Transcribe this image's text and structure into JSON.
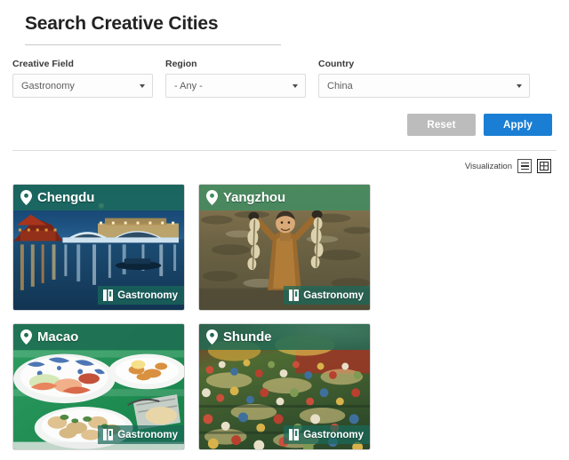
{
  "header": {
    "title": "Search Creative Cities"
  },
  "filters": {
    "fields": [
      {
        "label": "Creative Field",
        "value": "Gastronomy",
        "icon": "chevron-down-icon"
      },
      {
        "label": "Region",
        "value": "- Any -",
        "icon": "chevron-down-icon"
      },
      {
        "label": "Country",
        "value": "China",
        "icon": "chevron-down-icon"
      }
    ]
  },
  "actions": {
    "reset_label": "Reset",
    "apply_label": "Apply",
    "reset_color": "#bcbcbc",
    "apply_color": "#1a7fd4"
  },
  "visualization": {
    "label": "Visualization",
    "list_icon": "list-view-icon",
    "grid_icon": "grid-view-icon",
    "active": "grid"
  },
  "results": {
    "cards": [
      {
        "city": "Chengdu",
        "field": "Gastronomy",
        "pin_icon": "map-pin-icon",
        "field_icon": "gastronomy-icon",
        "header_color": "#1d6b5f"
      },
      {
        "city": "Yangzhou",
        "field": "Gastronomy",
        "pin_icon": "map-pin-icon",
        "field_icon": "gastronomy-icon",
        "header_color": "#3f8c61"
      },
      {
        "city": "Macao",
        "field": "Gastronomy",
        "pin_icon": "map-pin-icon",
        "field_icon": "gastronomy-icon",
        "header_color": "#1e6b52"
      },
      {
        "city": "Shunde",
        "field": "Gastronomy",
        "pin_icon": "map-pin-icon",
        "field_icon": "gastronomy-icon",
        "header_color": "#1f6b55"
      }
    ]
  }
}
